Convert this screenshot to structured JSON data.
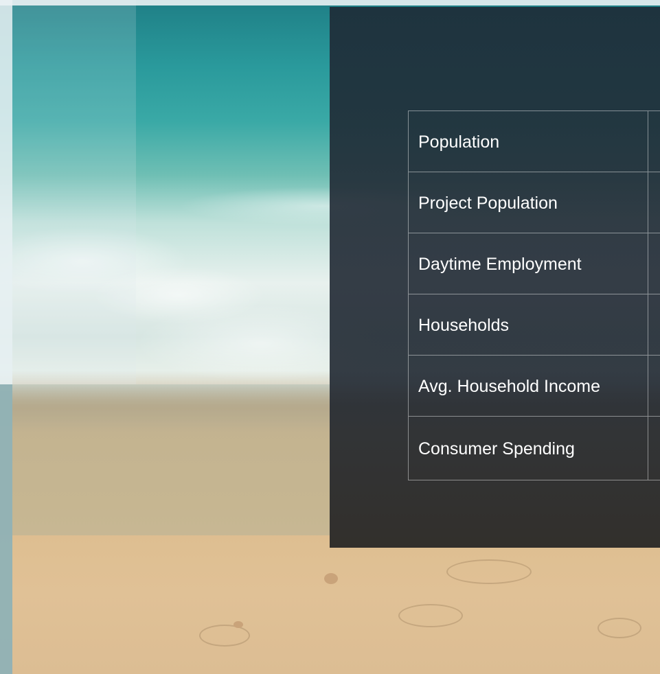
{
  "stats_table": {
    "rows": [
      {
        "label": "Population",
        "value": ""
      },
      {
        "label": "Project Population",
        "value": ""
      },
      {
        "label": "Daytime Employment",
        "value": ""
      },
      {
        "label": "Households",
        "value": ""
      },
      {
        "label": "Avg. Household Income",
        "value": ""
      },
      {
        "label": "Consumer Spending",
        "value": ""
      }
    ]
  },
  "background": {
    "image": "beach-photo",
    "colors": {
      "water": "#2a9a9c",
      "foam": "#e8f1ee",
      "sand": "#ddbd8e",
      "panel": "#1e2834"
    }
  }
}
